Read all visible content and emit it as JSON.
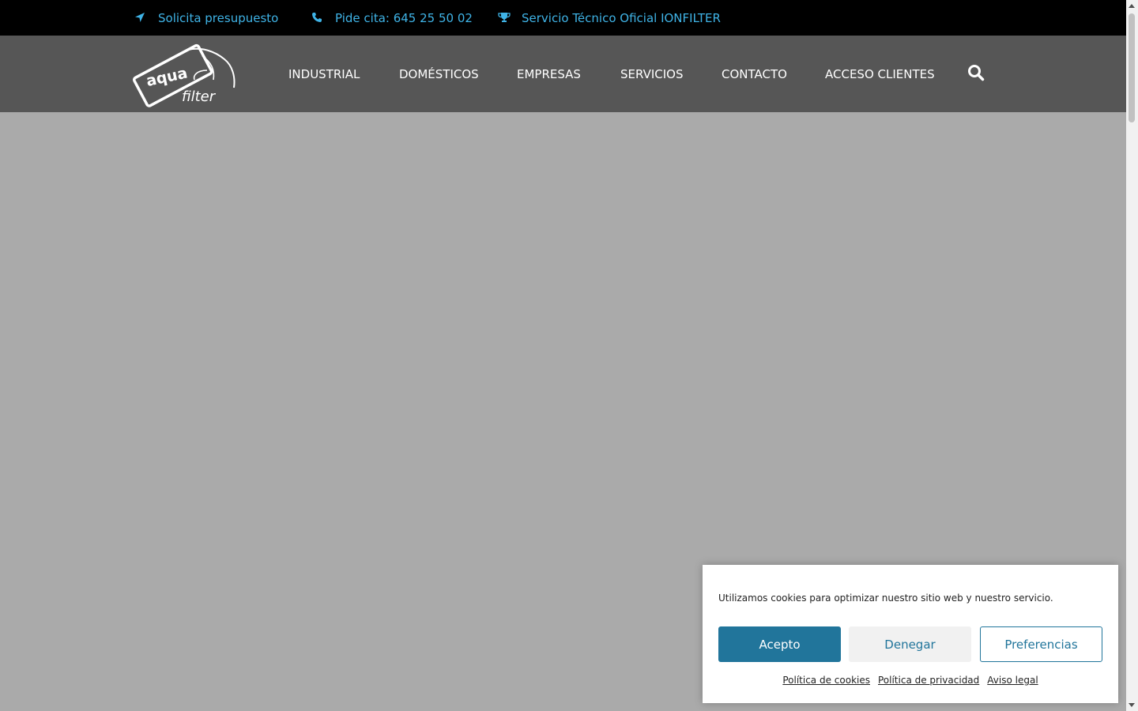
{
  "topbar": {
    "items": [
      {
        "label": "Solicita presupuesto",
        "icon": "location-arrow-icon"
      },
      {
        "label": "Pide cita: 645 25 50 02",
        "icon": "phone-icon"
      },
      {
        "label": "Servicio Técnico Oficial IONFILTER",
        "icon": "trophy-icon"
      }
    ],
    "text_color": "#3fb3e6"
  },
  "header": {
    "logo": {
      "line1": "aqua",
      "line2": "filter"
    },
    "nav": [
      {
        "label": "INDUSTRIAL"
      },
      {
        "label": "DOMÉSTICOS"
      },
      {
        "label": "EMPRESAS"
      },
      {
        "label": "SERVICIOS"
      },
      {
        "label": "CONTACTO"
      },
      {
        "label": "ACCESO CLIENTES"
      }
    ],
    "search_icon": "search-icon",
    "background": "#565656"
  },
  "cookie_banner": {
    "message": "Utilizamos cookies para optimizar nuestro sitio web y nuestro servicio.",
    "accept_label": "Acepto",
    "deny_label": "Denegar",
    "preferences_label": "Preferencias",
    "links": [
      "Política de cookies",
      "Política de privacidad",
      "Aviso legal"
    ],
    "accent_color": "#21759b"
  }
}
